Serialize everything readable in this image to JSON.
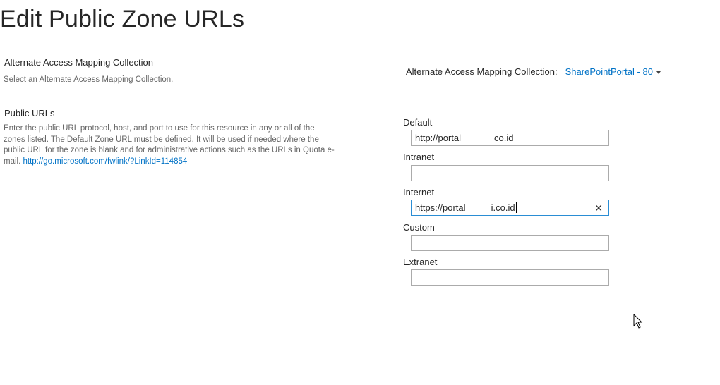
{
  "page": {
    "title": "Edit Public Zone URLs"
  },
  "aam_section": {
    "title": "Alternate Access Mapping Collection",
    "description": "Select an Alternate Access Mapping Collection.",
    "field_label": "Alternate Access Mapping Collection:",
    "selected_value": "SharePointPortal - 80"
  },
  "public_urls": {
    "title": "Public URLs",
    "description": "Enter the public URL protocol, host, and port to use for this resource in any or all of the zones listed.  The Default Zone URL must be defined.  It will be used if needed where the public URL for the zone is blank and for administrative actions such as the URLs in Quota e-mail. ",
    "link_text": "http://go.microsoft.com/fwlink/?LinkId=114854"
  },
  "zones": {
    "default": {
      "label": "Default",
      "value": "http://portal             co.id"
    },
    "intranet": {
      "label": "Intranet",
      "value": ""
    },
    "internet": {
      "label": "Internet",
      "value": "https://portal          i.co.id",
      "clear": "✕"
    },
    "custom": {
      "label": "Custom",
      "value": ""
    },
    "extranet": {
      "label": "Extranet",
      "value": ""
    }
  },
  "colors": {
    "link": "#0072c6",
    "focus_border": "#2a8dd4",
    "input_border": "#ababab"
  }
}
